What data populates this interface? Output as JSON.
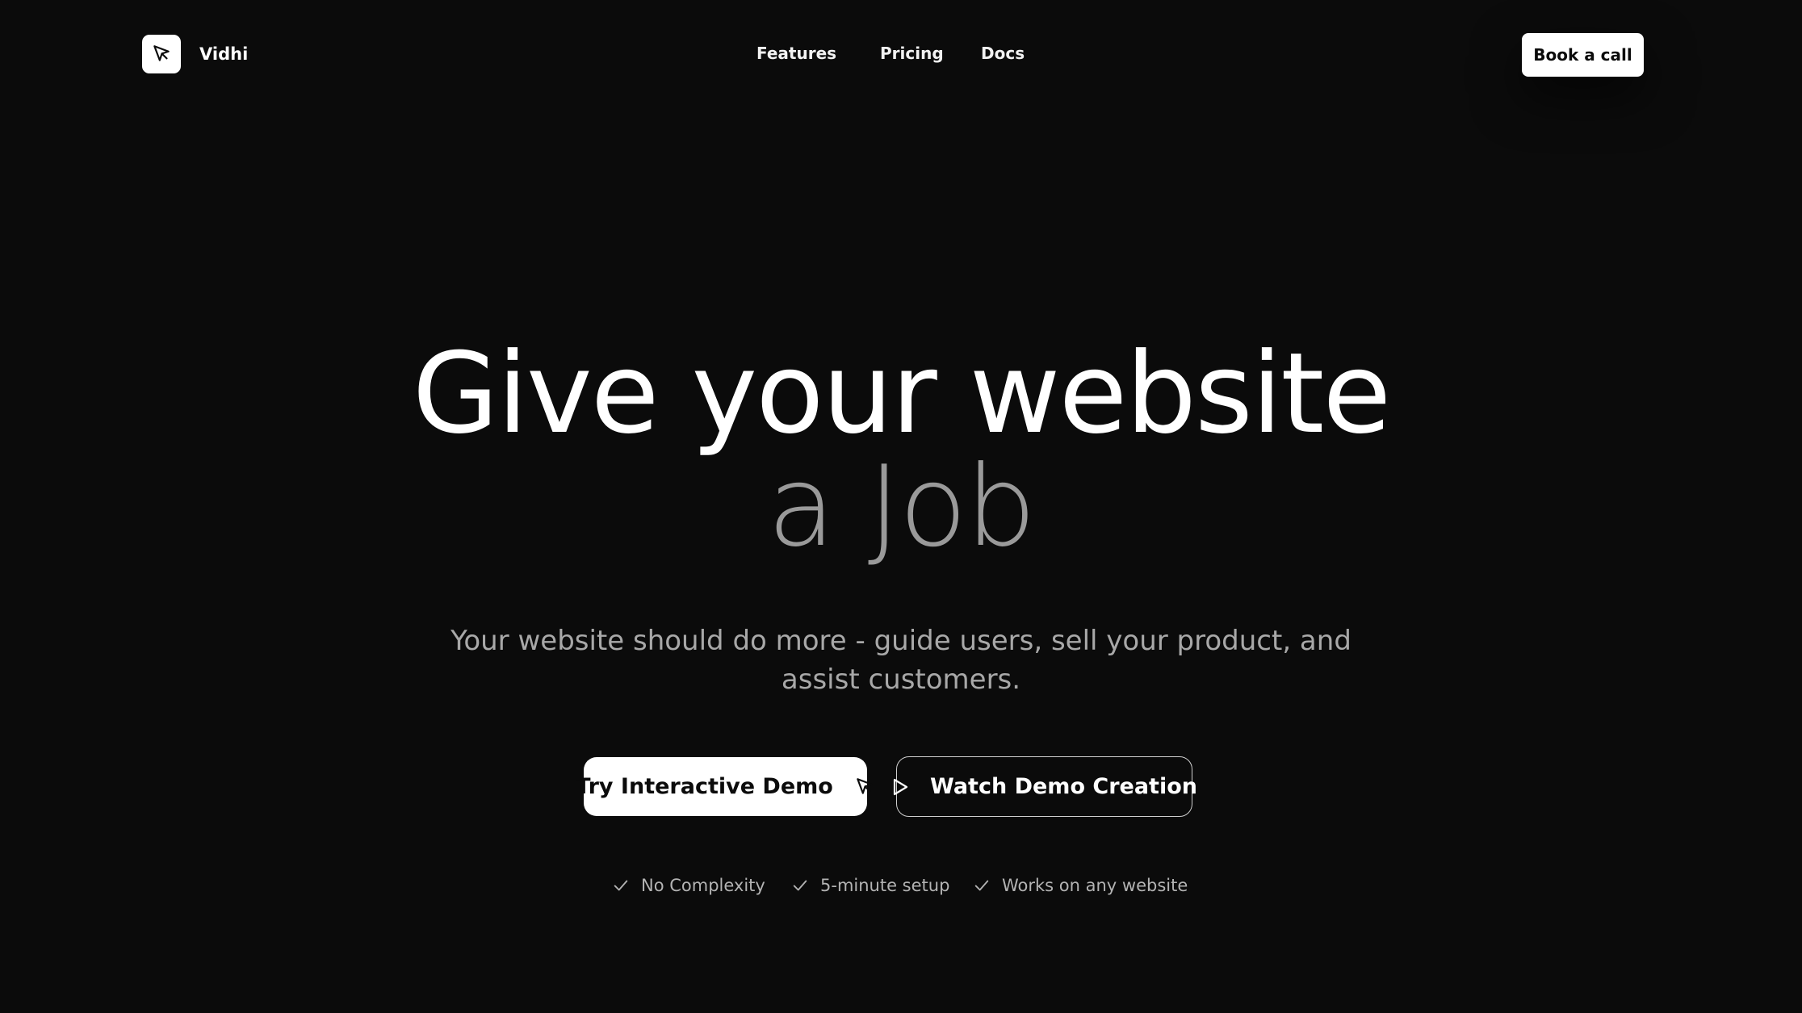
{
  "header": {
    "brand_name": "Vidhi",
    "brand_icon": "cursor-arrow-icon",
    "nav": [
      {
        "label": "Features"
      },
      {
        "label": "Pricing"
      },
      {
        "label": "Docs"
      }
    ],
    "cta_label": "Book a call"
  },
  "hero": {
    "title_line_1": "Give your website",
    "title_line_2": "a Job",
    "subtitle": "Your website should do more - guide users, sell your product, and assist customers."
  },
  "buttons": {
    "primary_label": "Try Interactive Demo",
    "primary_icon": "cursor-arrow-icon",
    "secondary_label": "Watch Demo Creation",
    "secondary_icon": "play-icon"
  },
  "checklist": [
    {
      "label": "No Complexity",
      "icon": "check-icon"
    },
    {
      "label": "5-minute setup",
      "icon": "check-icon"
    },
    {
      "label": "Works on any website",
      "icon": "check-icon"
    }
  ],
  "colors": {
    "background": "#0b0b0b",
    "primary_text": "#ffffff",
    "muted_text": "#9a9a9a",
    "button_bg": "#ffffff"
  }
}
